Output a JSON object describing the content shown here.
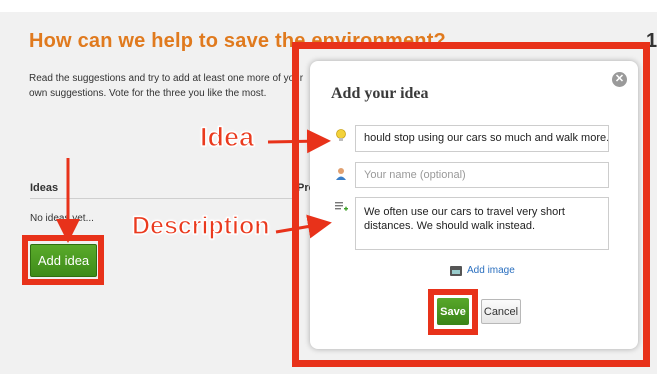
{
  "page": {
    "title": "How can we help to save the environment?",
    "page_number": "1",
    "intro": "Read the suggestions and try to add at least one more of your own suggestions. Vote for the three you like the most.",
    "ideas_heading": "Ideas",
    "pros_heading": "Pro",
    "no_ideas": "No ideas yet...",
    "add_idea_label": "Add idea"
  },
  "callouts": {
    "idea": "Idea",
    "description": "Description"
  },
  "modal": {
    "title": "Add your idea",
    "close_symbol": "✕",
    "idea_value": "hould stop using our cars so much and walk more.",
    "name_placeholder": "Your name (optional)",
    "description_value": "We often use our cars to travel very short distances. We should walk instead.",
    "add_image_label": "Add image",
    "save_label": "Save",
    "cancel_label": "Cancel"
  },
  "icons": {
    "idea": "lightbulb-icon",
    "name": "person-icon",
    "description": "note-add-icon",
    "image": "image-icon",
    "close": "close-icon"
  },
  "colors": {
    "title_orange": "#e07a1e",
    "annotation_red": "#e8321a",
    "button_green": "#4a9a22",
    "link_blue": "#2a6fbf"
  }
}
